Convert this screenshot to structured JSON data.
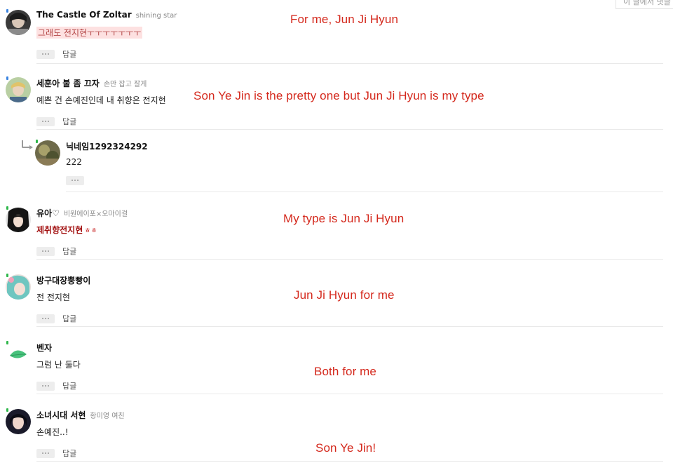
{
  "top_note": "이 글에서 댓글 찾기",
  "reply_label": "답글",
  "comments": [
    {
      "nickname": "The Castle Of Zoltar",
      "subtitle": "shining star",
      "text": "그래도 전지현ㅜㅜㅜㅜㅜㅜㅜ",
      "translation": "For me, Jun Ji Hyun"
    },
    {
      "nickname": "세훈아 불 좀 끄자",
      "subtitle": "손만 잡고 잘게",
      "text": "예쁜 건 손예진인데 내 취향은 전지현",
      "translation": "Son Ye Jin is the pretty one but Jun Ji Hyun is my type"
    },
    {
      "nickname": "닉네임1292324292",
      "subtitle": "",
      "text": "222",
      "translation": ""
    },
    {
      "nickname": "유아♡",
      "subtitle": "비원에이포×오마이걸",
      "text": "제취향전지현",
      "text_suffix": "ㅎㅎ",
      "translation": "My type is Jun Ji Hyun"
    },
    {
      "nickname": "방구대장뿡빵이",
      "subtitle": "",
      "text": "전 전지현",
      "translation": "Jun Ji Hyun for me"
    },
    {
      "nickname": "벤자",
      "subtitle": "",
      "text": "그럼 난 둘다",
      "translation": "Both for me"
    },
    {
      "nickname": "소녀시대 서현",
      "subtitle": "황미영 여친",
      "text": "손예진..!",
      "translation": "Son Ye Jin!"
    }
  ],
  "colors": {
    "annotation": "#d4281c",
    "divider": "#e9e9e9",
    "highlight_bg": "#fde1e1",
    "red_text": "#a31212"
  },
  "icons": [
    "more-options-icon",
    "reply-arrow-icon",
    "leaf-icon"
  ]
}
